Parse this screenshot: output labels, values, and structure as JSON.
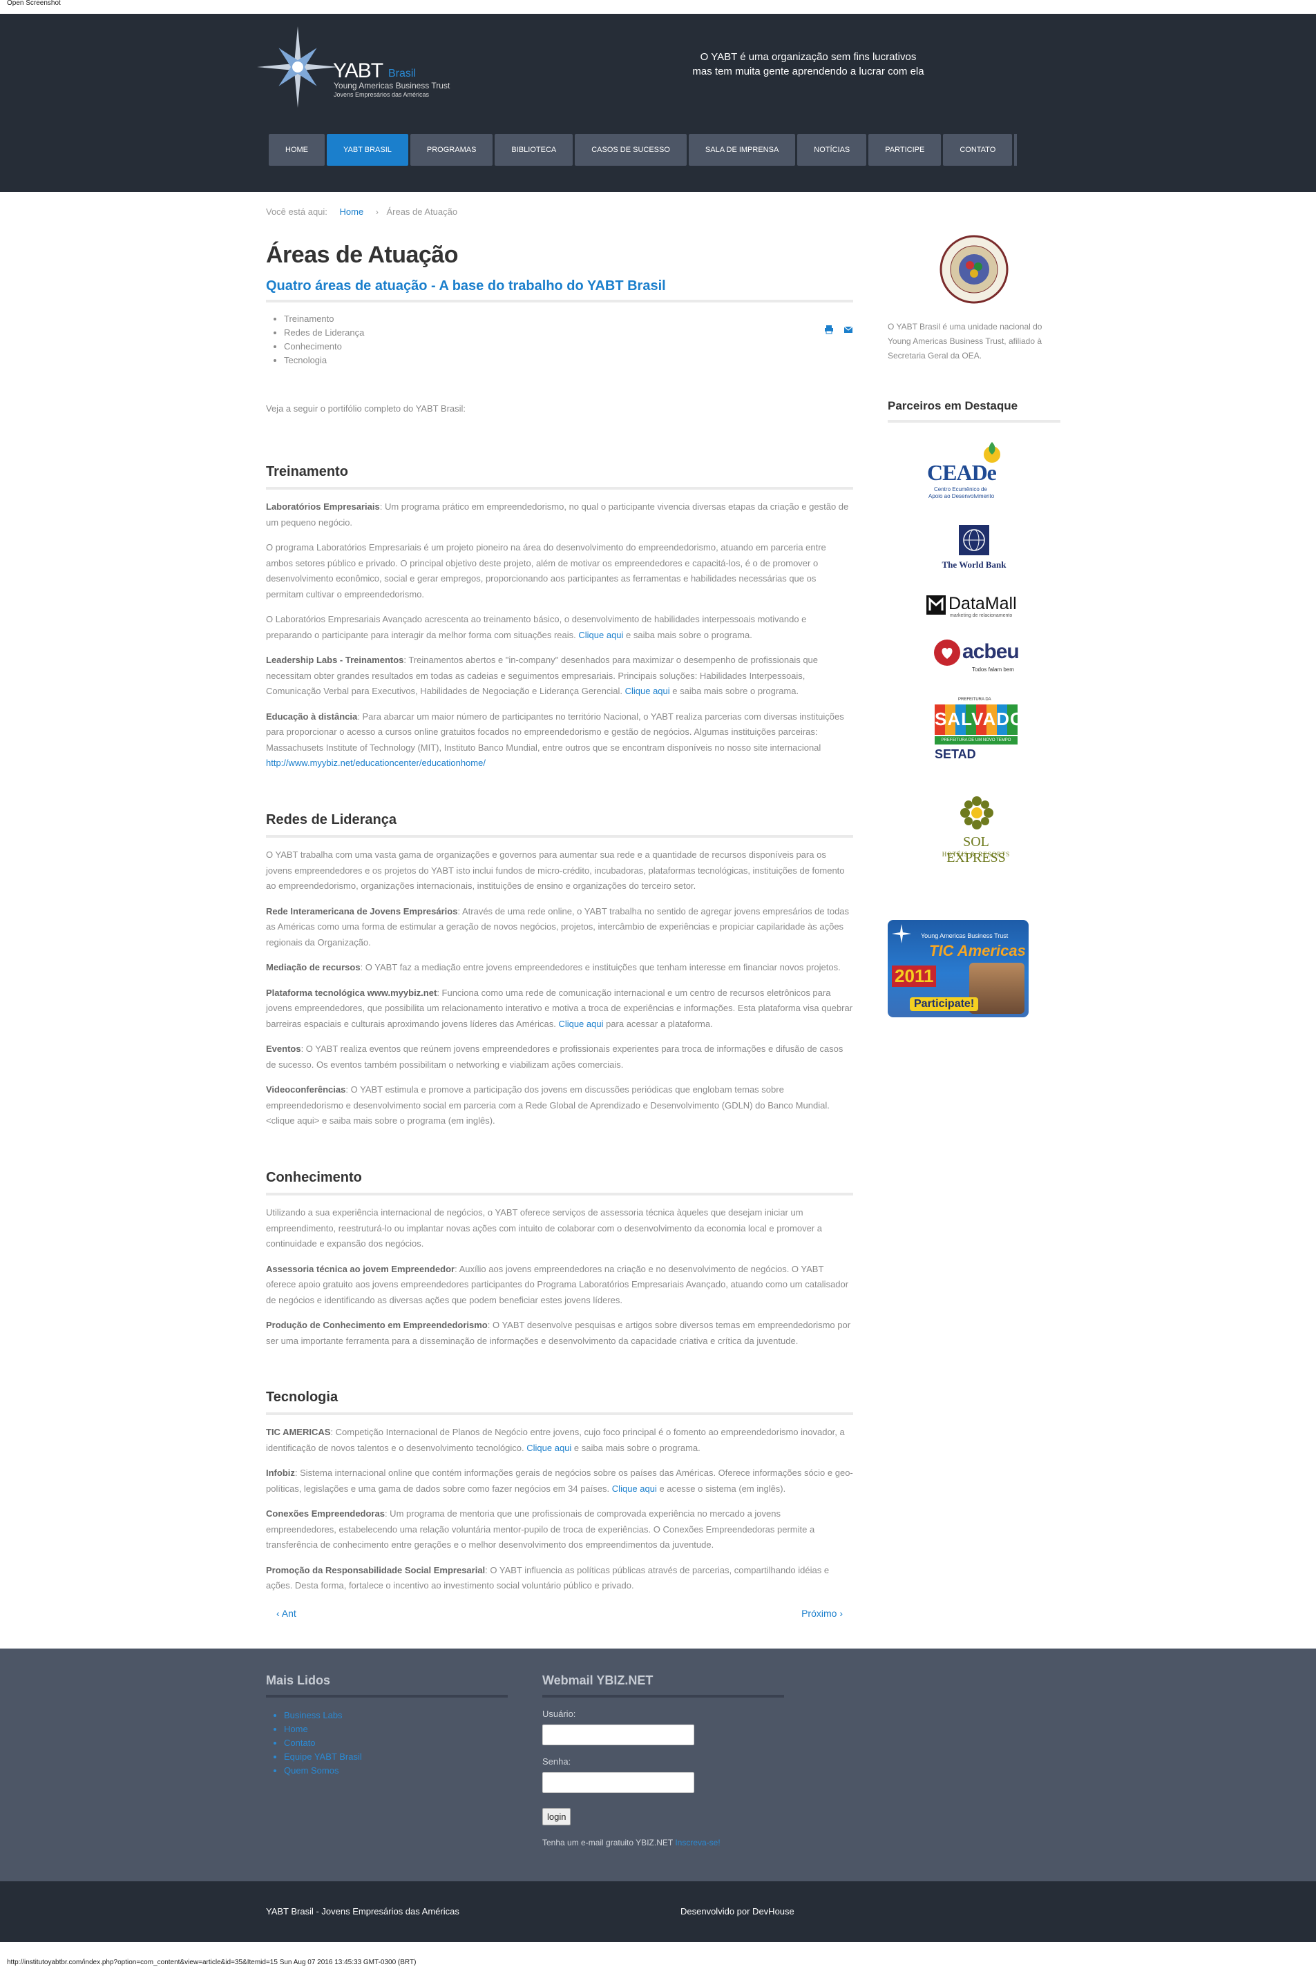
{
  "screenshot_label": "Open Screenshot",
  "header": {
    "logo": {
      "name": "YABT",
      "brasil": "Brasil",
      "trust": "Young Americas Business Trust",
      "jovens": "Jovens Empresários das Américas"
    },
    "tagline_line1": "O YABT é uma organização sem fins lucrativos",
    "tagline_line2": "mas tem muita gente aprendendo a lucrar com ela"
  },
  "nav": {
    "items": [
      "HOME",
      "YABT BRASIL",
      "PROGRAMAS",
      "BIBLIOTECA",
      "CASOS DE SUCESSO",
      "SALA DE IMPRENSA",
      "NOTÍCIAS",
      "PARTICIPE",
      "CONTATO"
    ],
    "active_index": 1
  },
  "breadcrumb": {
    "prefix": "Você está aqui:",
    "home": "Home",
    "current": "Áreas de Atuação"
  },
  "article": {
    "title": "Áreas de Atuação",
    "subtitle": "Quatro áreas de atuação - A base do trabalho do YABT Brasil",
    "topics": [
      "Treinamento",
      "Redes de Liderança",
      "Conhecimento",
      "Tecnologia"
    ],
    "intro": "Veja a seguir o portifólio completo do YABT Brasil:",
    "treinamento": {
      "heading": "Treinamento",
      "p1_b": "Laboratórios Empresariais",
      "p1": ": Um programa prático em empreendedorismo, no qual o participante vivencia diversas etapas da criação e gestão de um pequeno negócio.",
      "p2": "O programa Laboratórios Empresariais é um projeto pioneiro na área do desenvolvimento do empreendedorismo, atuando em parceria entre ambos setores público e privado. O principal objetivo deste projeto, além de motivar os empreendedores e capacitá-los, é o de promover o desenvolvimento econômico, social e gerar empregos, proporcionando aos participantes as ferramentas e habilidades necessárias que os permitam cultivar o empreendedorismo.",
      "p3": "O Laboratórios Empresariais Avançado acrescenta ao treinamento básico, o desenvolvimento de habilidades interpessoais motivando e preparando o participante para interagir da melhor forma com situações reais.",
      "p3_link": "Clique aqui",
      "p3_end": " e saiba mais sobre o programa.",
      "p4_b": "Leadership Labs - Treinamentos",
      "p4": ": Treinamentos abertos e \"in-company\" desenhados para maximizar o desempenho de profissionais que necessitam obter grandes resultados em todas as cadeias e seguimentos empresariais. Principais soluções: Habilidades Interpessoais, Comunicação Verbal para Executivos, Habilidades de Negociação e Liderança Gerencial.",
      "p4_link": "Clique aqui",
      "p4_end": " e saiba mais sobre o programa.",
      "p5_b": "Educação à distância",
      "p5": ": Para abarcar um maior número de participantes no território Nacional, o YABT realiza parcerias com diversas instituições para proporcionar o acesso a cursos online gratuitos focados no empreendedorismo e gestão de negócios. Algumas instituições parceiras: Massachusets Institute of Technology (MIT), Instituto Banco Mundial, entre outros que se encontram disponíveis no nosso site internacional",
      "p5_link": "http://www.myybiz.net/educationcenter/educationhome/"
    },
    "redes": {
      "heading": "Redes de Liderança",
      "p1": "O YABT trabalha com uma vasta gama de organizações e governos para aumentar sua rede e a quantidade de recursos disponíveis para os jovens empreendedores e os projetos do YABT isto inclui fundos de micro-crédito, incubadoras, plataformas tecnológicas, instituições de fomento ao empreendedorismo, organizações internacionais, instituições de ensino e organizações do terceiro setor.",
      "p2_b": "Rede Interamericana de Jovens Empresários",
      "p2": ": Através de uma rede online, o YABT trabalha no sentido de agregar jovens empresários de todas as Américas como uma forma de estimular a geração de novos negócios, projetos, intercâmbio de experiências e propiciar capilaridade às ações regionais da Organização.",
      "p3_b": "Mediação de recursos",
      "p3": ": O YABT faz a mediação entre jovens empreendedores e instituições que tenham interesse em financiar novos projetos.",
      "p4_b": "Plataforma tecnológica www.myybiz.net",
      "p4": ": Funciona como uma rede de comunicação internacional e um centro de recursos eletrônicos para jovens empreendedores, que possibilita um relacionamento interativo e motiva a troca de experiências e informações. Esta plataforma visa quebrar barreiras espaciais e culturais aproximando jovens líderes das Américas.",
      "p4_link": "Clique aqui",
      "p4_end": " para acessar a plataforma.",
      "p5_b": "Eventos",
      "p5": ": O YABT realiza eventos que reúnem jovens empreendedores e profissionais experientes para troca de informações e difusão de casos de sucesso. Os eventos também possibilitam o networking e viabilizam ações comerciais.",
      "p6_b": "Videoconferências",
      "p6": ": O YABT estimula e promove a participação dos jovens em discussões periódicas que englobam temas sobre empreendedorismo e desenvolvimento social em parceria com a Rede Global de Aprendizado e Desenvolvimento (GDLN) do Banco Mundial. <clique aqui> e saiba mais sobre o programa (em inglês)."
    },
    "conhecimento": {
      "heading": "Conhecimento",
      "p1": "Utilizando a sua experiência internacional de negócios, o YABT oferece serviços de assessoria técnica àqueles que desejam iniciar um empreendimento, reestruturá-lo ou implantar novas ações com intuito de colaborar com o desenvolvimento da economia local e promover a continuidade e expansão dos negócios.",
      "p2_b": "Assessoria técnica ao jovem Empreendedor",
      "p2": ": Auxílio aos jovens empreendedores na criação e no desenvolvimento de negócios. O YABT oferece apoio gratuito aos jovens empreendedores participantes do Programa Laboratórios Empresariais Avançado, atuando como um catalisador de negócios e identificando as diversas ações que podem beneficiar estes jovens líderes.",
      "p3_b": "Produção de Conhecimento em Empreendedorismo",
      "p3": ": O YABT desenvolve pesquisas e artigos sobre diversos temas em empreendedorismo por ser uma importante ferramenta para a disseminação de informações e desenvolvimento da capacidade criativa e crítica da juventude."
    },
    "tecnologia": {
      "heading": "Tecnologia",
      "p1_b": "TIC AMERICAS",
      "p1": ": Competição Internacional de Planos de Negócio entre jovens, cujo foco principal é o fomento ao empreendedorismo inovador, a identificação de novos talentos e o desenvolvimento tecnológico.",
      "p1_link": "Clique aqui",
      "p1_end": " e saiba mais sobre o programa.",
      "p2_b": "Infobiz",
      "p2": ": Sistema internacional online que contém informações gerais de negócios sobre os países das Américas. Oferece informações sócio e geo-políticas, legislações e uma gama de dados sobre como fazer negócios em 34 países.",
      "p2_link": "Clique aqui",
      "p2_end": " e acesse o sistema (em inglês).",
      "p3_b": "Conexões Empreendedoras",
      "p3": ": Um programa de mentoria que une profissionais de comprovada experiência no mercado a jovens empreendedores, estabelecendo uma relação voluntária mentor-pupilo de troca de experiências. O Conexões Empreendedoras permite a transferência de conhecimento entre gerações e o melhor desenvolvimento dos empreendimentos da juventude.",
      "p4_b": "Promoção da Responsabilidade Social Empresarial",
      "p4": ": O YABT influencia as políticas públicas através de parcerias, compartilhando idéias e ações. Desta forma, fortalece o incentivo ao investimento social voluntário público e privado."
    },
    "pager": {
      "prev": "Ant",
      "next": "Próximo"
    }
  },
  "sidebar": {
    "description": "O YABT Brasil é uma unidade nacional do Young Americas Business Trust, afiliado à Secretaria Geral da OEA.",
    "partners_title": "Parceiros em Destaque",
    "partners": {
      "ceade": {
        "name": "CEADe",
        "tagline_1": "Centro Ecumênico de",
        "tagline_2": "Apoio ao Desenvolvimento"
      },
      "worldbank": {
        "name": "The World Bank"
      },
      "datamall": {
        "name": "DataMall",
        "tagline": "marketing de relacionamento"
      },
      "acbeu": {
        "name": "acbeu",
        "tagline": "Todos falam bem"
      },
      "salvador": {
        "top": "PREFEITURA DA",
        "name": "SALVADOR",
        "sub": "PREFEITURA DE UM NOVO TEMPO",
        "setad": "SETAD"
      },
      "solexpress": {
        "name": "SOL EXPRESS",
        "tagline": "HOTÉIS & RESORTS"
      }
    },
    "tic_banner": {
      "top": "Young Americas Business Trust",
      "title": "TIC Americas",
      "year": "2011",
      "cta": "Participate!"
    }
  },
  "footer": {
    "mais_lidos": {
      "title": "Mais Lidos",
      "items": [
        "Business Labs",
        "Home",
        "Contato",
        "Equipe YABT Brasil",
        "Quem Somos"
      ]
    },
    "webmail": {
      "title": "Webmail YBIZ.NET",
      "user_label": "Usuário:",
      "pass_label": "Senha:",
      "login_button": "login",
      "note": "Tenha um e-mail gratuito YBIZ.NET",
      "note_link": "Inscreva-se!"
    }
  },
  "bottom": {
    "left": "YABT Brasil - Jovens Empresários das Américas",
    "right": "Desenvolvido por DevHouse"
  },
  "statusbar": "http://institutoyabtbr.com/index.php?option=com_content&view=article&id=35&Itemid=15 Sun Aug 07 2016 13:45:33 GMT-0300 (BRT)",
  "colors": {
    "header_bg": "#262d37",
    "nav_bg": "#4d5666",
    "accent": "#1b7fcc",
    "footer_bg": "#4d5666"
  }
}
